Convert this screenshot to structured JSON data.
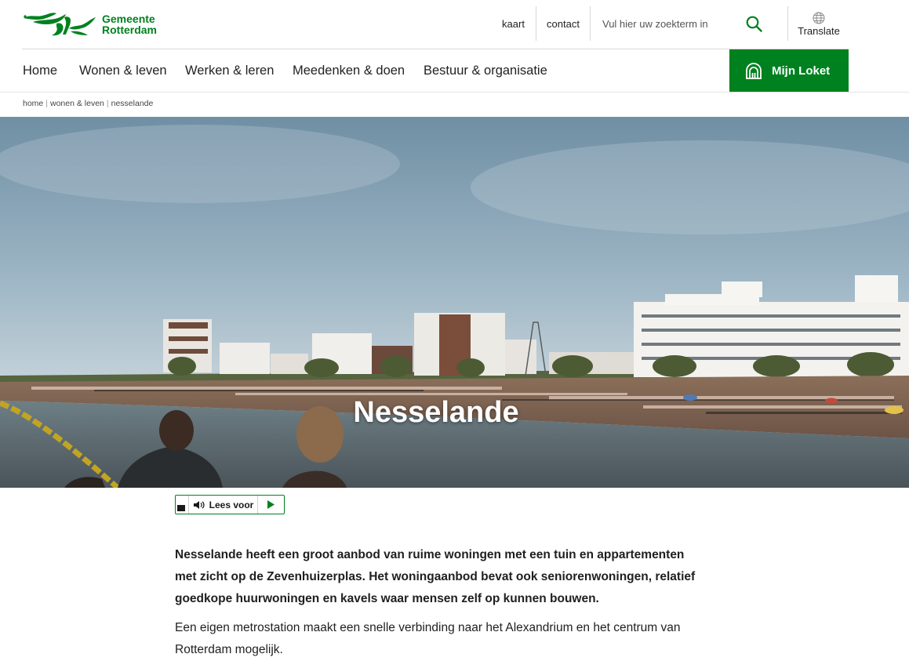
{
  "brand": {
    "name_line1": "Gemeente",
    "name_line2": "Rotterdam",
    "color": "#00811f"
  },
  "utility_nav": {
    "map_label": "kaart",
    "contact_label": "contact",
    "search_placeholder": "Vul hier uw zoekterm in",
    "search_icon": "search-icon",
    "translate_label": "Translate",
    "translate_icon": "globe-icon"
  },
  "main_nav": {
    "items": [
      {
        "label": "Home"
      },
      {
        "label": "Wonen & leven"
      },
      {
        "label": "Werken & leren"
      },
      {
        "label": "Meedenken & doen"
      },
      {
        "label": "Bestuur & organisatie"
      }
    ],
    "loket_label": "Mijn Loket",
    "loket_icon": "counter-icon"
  },
  "breadcrumb": [
    "home",
    "wonen & leven",
    "nesselande"
  ],
  "hero": {
    "title": "Nesselande",
    "image_icon": "beach-photo"
  },
  "read_aloud": {
    "label": "Lees voor",
    "menu_icon": "menu-icon",
    "speaker_icon": "speaker-icon",
    "play_icon": "play-icon"
  },
  "content": {
    "intro": "Nesselande heeft een groot aanbod van ruime woningen met een tuin en appartementen met zicht op de Zevenhuizerplas. Het woningaanbod bevat ook seniorenwoningen, relatief goedkope huurwoningen en kavels waar mensen zelf op kunnen bouwen.",
    "paragraph": "Een eigen metrostation maakt een snelle verbinding naar het Alexandrium en het centrum van Rotterdam mogelijk."
  }
}
